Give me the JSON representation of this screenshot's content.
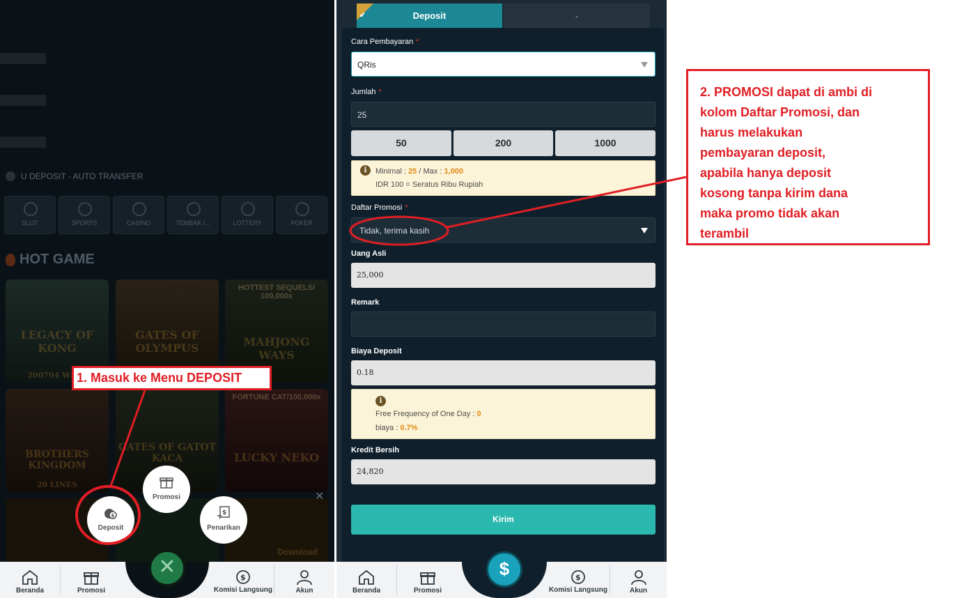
{
  "left": {
    "auto_transfer_text": "U DEPOSIT - AUTO TRANSFER",
    "categories": [
      "SLOT",
      "SPORTS",
      "CASINO",
      "TEMBAK I...",
      "LOTTERY",
      "POKER"
    ],
    "hot_game_title": "HOT GAME",
    "games": [
      {
        "title": "LEGACY OF KONG",
        "caption": "200704 WAYS",
        "top": ""
      },
      {
        "title": "GATES OF OLYMPUS",
        "caption": "",
        "top": ""
      },
      {
        "title": "MAHJONG WAYS",
        "caption": "",
        "top": "HOTTEST SEQUELS/ 100,000x"
      },
      {
        "title": "BROTHERS KINGDOM",
        "caption": "20 LINES",
        "top": ""
      },
      {
        "title": "GATES OF GATOT KACA",
        "caption": "",
        "top": ""
      },
      {
        "title": "LUCKY NEKO",
        "caption": "",
        "top": "FORTUNE CAT/100,000x"
      }
    ],
    "download_label": "Download",
    "fab_menu": {
      "deposit": "Deposit",
      "promosi": "Promosi",
      "penarikan": "Penarikan"
    },
    "bottom_nav": [
      "Beranda",
      "Promosi",
      "Komisi Langsung",
      "Akun"
    ]
  },
  "deposit_form": {
    "tab_deposit": "Deposit",
    "tab_other": "-",
    "payment_method_label": "Cara Pembayaran",
    "payment_method_value": "QRis",
    "amount_label": "Jumlah",
    "amount_value": "25",
    "quick_amounts": [
      "50",
      "200",
      "1000"
    ],
    "limits": {
      "min_label": "Minimal : ",
      "min_value": "25",
      "sep": " / Max : ",
      "max_value": "1,000",
      "note": "IDR 100 = Seratus Ribu Rupiah"
    },
    "promo_label": "Daftar Promosi",
    "promo_value": "Tidak, terima kasih",
    "real_money_label": "Uang Asli",
    "real_money_value": "25,000",
    "remark_label": "Remark",
    "remark_value": "",
    "fee_label": "Biaya Deposit",
    "fee_value": "0.18",
    "fee_info": {
      "freq_label": "Free Frequency of One Day : ",
      "freq_value": "0",
      "rate_label": "biaya : ",
      "rate_value": "0.7%"
    },
    "net_credit_label": "Kredit Bersih",
    "net_credit_value": "24,820",
    "submit_label": "Kirim",
    "required_mark": "*",
    "bottom_nav": [
      "Beranda",
      "Promosi",
      "Komisi Langsung",
      "Akun"
    ]
  },
  "annotations": {
    "step1": "1. Masuk ke Menu DEPOSIT",
    "step2_lines": [
      "2. PROMOSI dapat di ambi di",
      "kolom Daftar Promosi, dan",
      "harus melakukan",
      "pembayaran deposit,",
      "apabila hanya deposit",
      "kosong tanpa kirim dana",
      "maka promo tidak akan",
      "terambil"
    ]
  },
  "colors": {
    "accent_teal": "#2bb8ae",
    "tab_active": "#1c8896",
    "annotation_red": "#e01e24",
    "highlight_orange": "#e08a14"
  }
}
